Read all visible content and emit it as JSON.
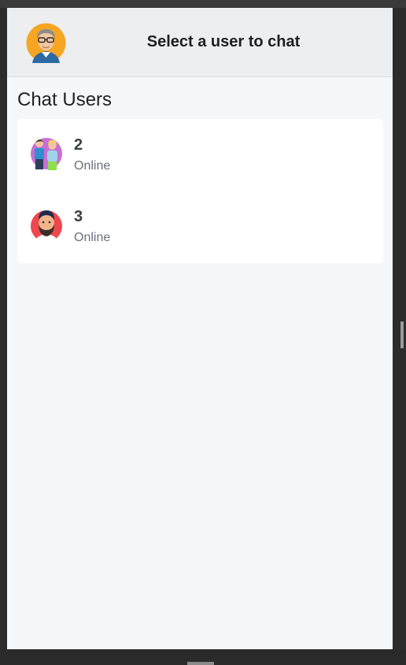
{
  "header": {
    "title": "Select a user to chat",
    "avatar_icon": "man-with-glasses-avatar"
  },
  "section": {
    "title": "Chat Users"
  },
  "users": [
    {
      "name": "2",
      "status": "Online",
      "avatar_icon": "couple-avatar"
    },
    {
      "name": "3",
      "status": "Online",
      "avatar_icon": "bearded-man-avatar"
    }
  ],
  "colors": {
    "header_bg": "#eceef0",
    "page_bg": "#f6f7f9",
    "card_bg": "#ffffff",
    "header_avatar_bg": "#f6a623",
    "user2_avatar_bg": "#c86fd4",
    "user3_avatar_bg": "#f0474f"
  }
}
